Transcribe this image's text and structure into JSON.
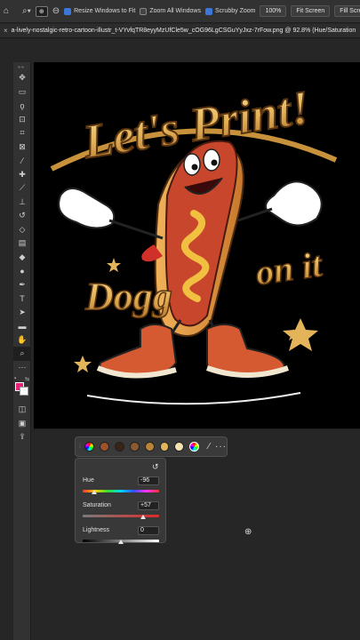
{
  "options_bar": {
    "checkbox_resize_label": "Resize Windows to Fit",
    "checkbox_zoom_all_label": "Zoom All Windows",
    "checkbox_scrubby_label": "Scrubby Zoom",
    "zoom_value": "100%",
    "fit_screen_label": "Fit Screen",
    "fill_screen_label": "Fill Screen"
  },
  "document_tab": {
    "title": "a-lively-nostalgic-retro-cartoon-illustr_t-VYvfqTR8eyyMzUfCle5w_cOG96LgCSGuYyJxz-7rFow.png @ 92.8% (Hue/Saturation"
  },
  "artwork": {
    "headline": "Let's Print!",
    "text_left": "Dogg",
    "text_right": "on it"
  },
  "colors": {
    "foreground": "#e8207a",
    "background": "#ffffff",
    "swatches": [
      "#a0502a",
      "#3a2418",
      "#8a5a30",
      "#b8843a",
      "#e0b45a",
      "#f4e2b0"
    ]
  },
  "hsl_panel": {
    "hue_label": "Hue",
    "hue_value": "-96",
    "saturation_label": "Saturation",
    "saturation_value": "+57",
    "lightness_label": "Lightness",
    "lightness_value": "0"
  }
}
